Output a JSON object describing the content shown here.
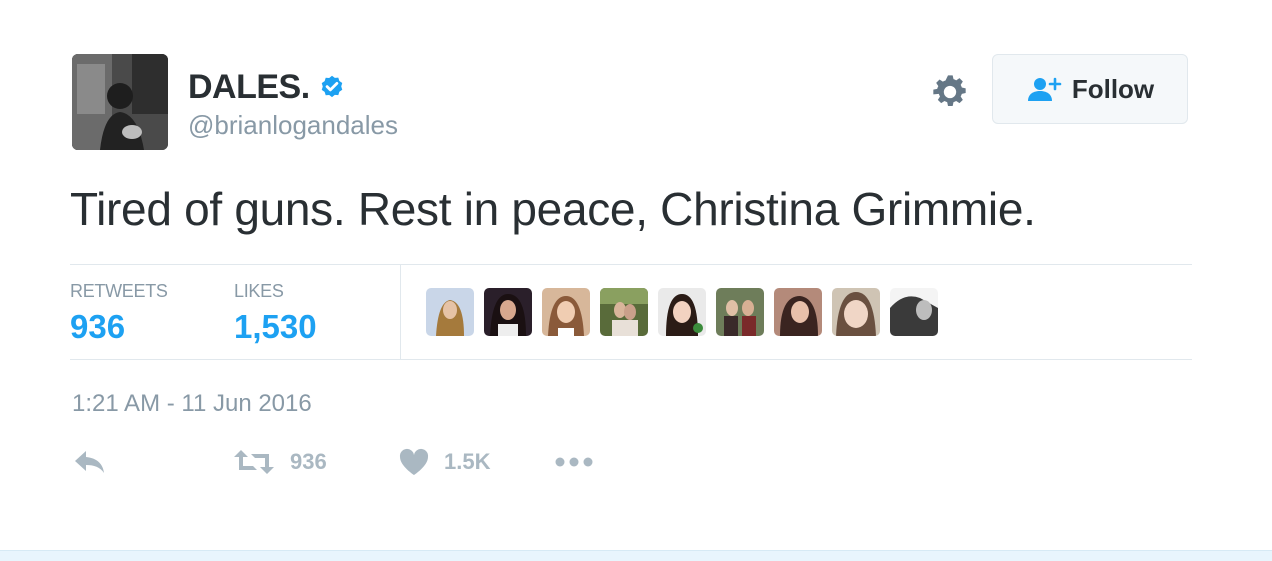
{
  "user": {
    "display_name": "DALES.",
    "username": "@brianlogandales",
    "verified": true
  },
  "header": {
    "follow_label": "Follow"
  },
  "tweet": {
    "text": "Tired of guns. Rest in peace, Christina Grimmie.",
    "timestamp": "1:21 AM - 11 Jun 2016"
  },
  "stats": {
    "retweets_label": "RETWEETS",
    "retweets_value": "936",
    "likes_label": "LIKES",
    "likes_value": "1,530"
  },
  "actions": {
    "retweet_count": "936",
    "like_count": "1.5K"
  },
  "colors": {
    "accent": "#1da1f2",
    "muted": "#8899a6",
    "action_icon": "#aab8c2"
  }
}
